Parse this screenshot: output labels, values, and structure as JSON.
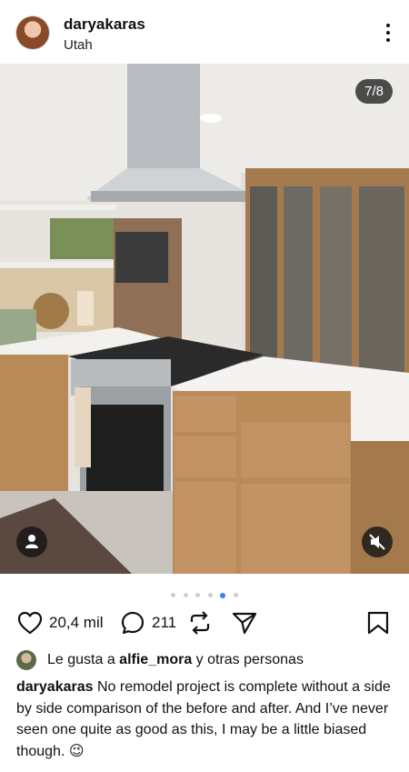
{
  "post": {
    "username": "daryakaras",
    "location": "Utah",
    "image_counter": "7/8",
    "carousel": {
      "total_dots": 6,
      "active_index": 4
    },
    "likes_count": "20,4 mil",
    "comments_count": "211",
    "liked_by_prefix": "Le gusta a ",
    "liked_by_user": "alfie_mora",
    "liked_by_suffix": " y otras personas",
    "caption_user": "daryakaras",
    "caption_text": " No remodel project is complete without a side by side comparison of the before and after. And I’ve never seen one quite as good as this, I may be a little biased though. 😉"
  },
  "icons": {
    "more": "more-vertical-icon",
    "like": "heart-icon",
    "comment": "comment-icon",
    "repost": "repost-icon",
    "share": "send-icon",
    "save": "bookmark-icon",
    "tag": "user-tag-icon",
    "mute": "mute-icon"
  },
  "colors": {
    "active_dot": "#3b82f6"
  }
}
